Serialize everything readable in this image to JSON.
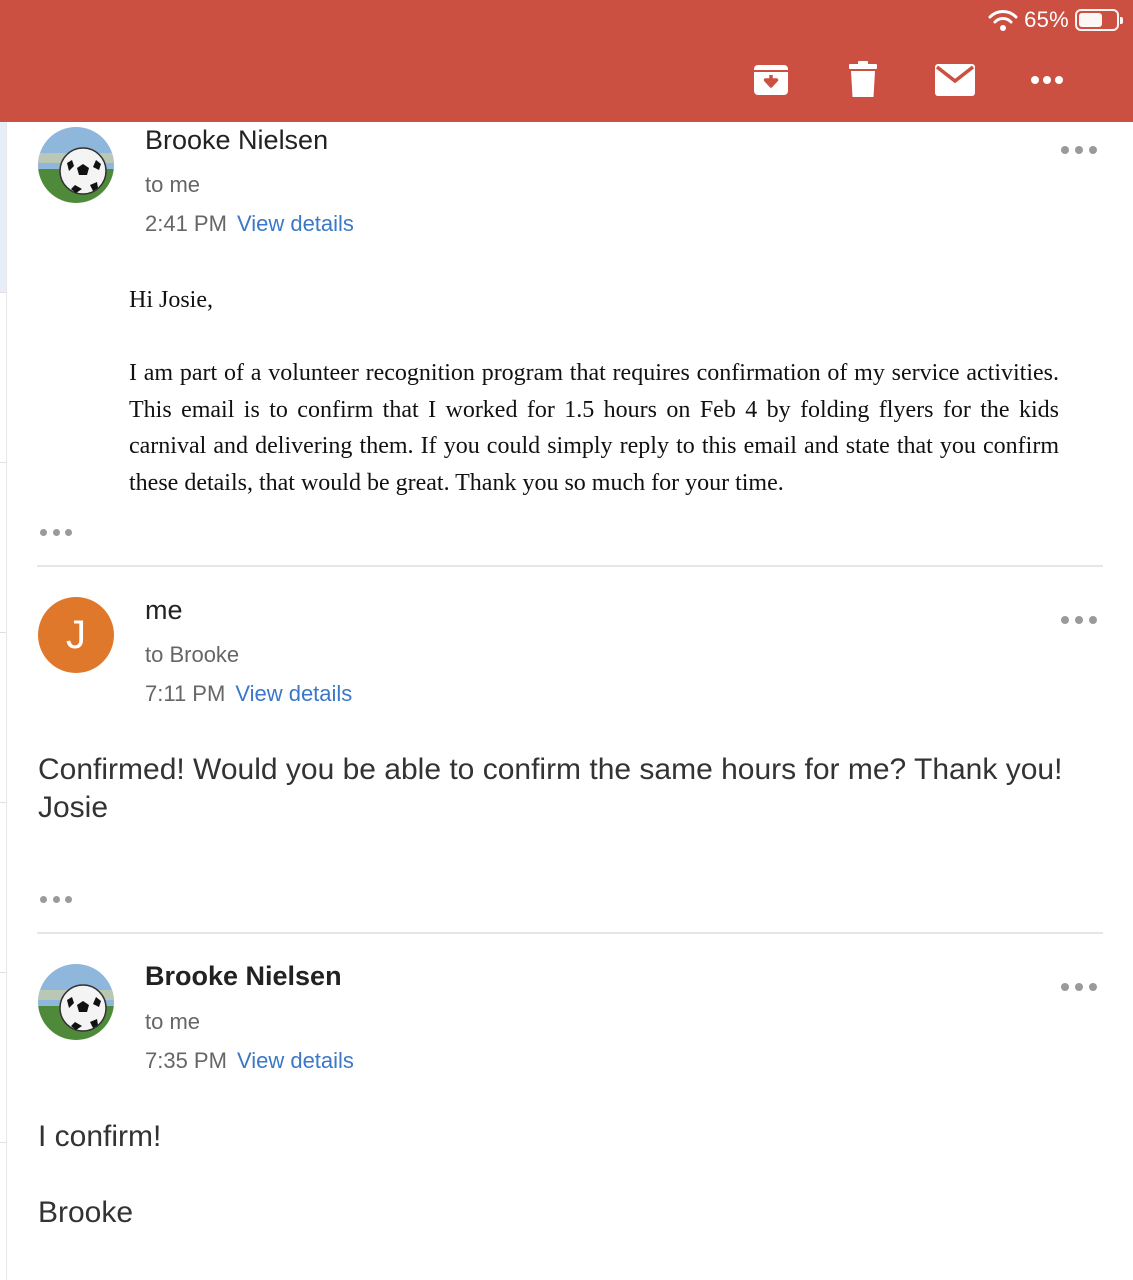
{
  "status_bar": {
    "battery_percent": "65%",
    "battery_level": 0.65,
    "icons": [
      "wifi-icon",
      "battery-icon"
    ]
  },
  "toolbar": {
    "bar_color": "#cb5042",
    "actions": [
      "archive-icon",
      "trash-icon",
      "mail-icon",
      "more-icon"
    ]
  },
  "messages": [
    {
      "sender": "Brooke Nielsen",
      "recipient": "to me",
      "time": "2:41 PM",
      "details_link": "View details",
      "greeting": "Hi Josie,",
      "body": "I am part of a volunteer recognition program that requires confirmation of my service activities. This email is to confirm that I worked for 1.5 hours on Feb 4 by folding flyers for the kids carnival and delivering them. If you could simply reply to this email and state that you confirm these details, that would be great. Thank you so much for your time."
    },
    {
      "sender": "me",
      "avatar_letter": "J",
      "avatar_color": "#e0782c",
      "recipient": "to Brooke",
      "time": "7:11 PM",
      "details_link": "View details",
      "body_line1": "Confirmed! Would you be able to confirm the same hours for me? Thank you!",
      "body_line2": "Josie"
    },
    {
      "sender": "Brooke Nielsen",
      "recipient": "to me",
      "time": "7:35 PM",
      "details_link": "View details",
      "body_line1": "I confirm!",
      "body_line2": "Brooke"
    }
  ],
  "link_color": "#3b78c7"
}
